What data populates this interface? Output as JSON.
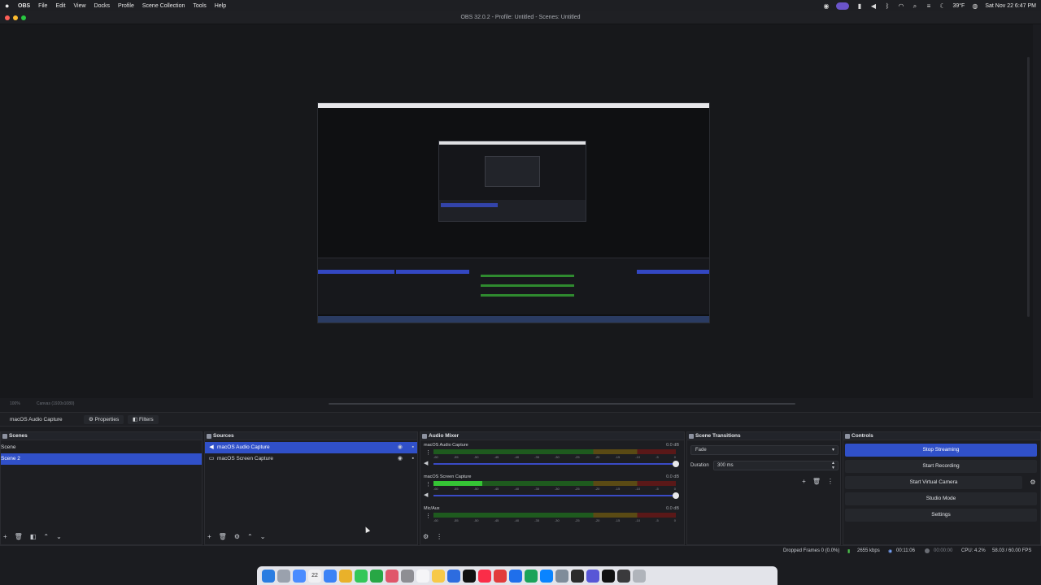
{
  "menubar": {
    "app": "OBS",
    "items": [
      "File",
      "Edit",
      "View",
      "Docks",
      "Profile",
      "Scene Collection",
      "Tools",
      "Help"
    ],
    "weather": "39°F",
    "datetime": "Sat Nov 22 6:47 PM"
  },
  "window": {
    "title": "OBS 32.0.2 - Profile: Untitled - Scenes: Untitled"
  },
  "preview": {
    "zoom": "100%",
    "canvas": "Canvas (1920x1080)"
  },
  "source_bar": {
    "selected_source": "macOS Audio Capture",
    "properties_label": "Properties",
    "filters_label": "Filters"
  },
  "scenes": {
    "title": "Scenes",
    "items": [
      {
        "label": "Scene",
        "selected": false
      },
      {
        "label": "Scene 2",
        "selected": true
      }
    ]
  },
  "sources": {
    "title": "Sources",
    "items": [
      {
        "label": "macOS Audio Capture",
        "icon": "speaker-icon",
        "selected": true
      },
      {
        "label": "macOS Screen Capture",
        "icon": "monitor-icon",
        "selected": false
      }
    ]
  },
  "mixer": {
    "title": "Audio Mixer",
    "ticks": [
      "-60",
      "-55",
      "-50",
      "-45",
      "-40",
      "-35",
      "-30",
      "-25",
      "-20",
      "-15",
      "-10",
      "-5",
      "0"
    ],
    "channels": [
      {
        "name": "macOS Audio Capture",
        "db": "0.0 dB",
        "level": 0.0
      },
      {
        "name": "macOS Screen Capture",
        "db": "0.0 dB",
        "level": 0.2
      },
      {
        "name": "Mic/Aux",
        "db": "0.0 dB",
        "level": 0.0
      }
    ]
  },
  "transitions": {
    "title": "Scene Transitions",
    "selected": "Fade",
    "duration_label": "Duration",
    "duration_value": "300 ms"
  },
  "controls": {
    "title": "Controls",
    "buttons": [
      "Stop Streaming",
      "Start Recording",
      "Start Virtual Camera",
      "Studio Mode",
      "Settings"
    ]
  },
  "status": {
    "dropped_frames": "Dropped Frames 0 (0.0%)",
    "bitrate": "2655 kbps",
    "stream_time": "00:11:06",
    "record_time": "00:00:00",
    "cpu": "CPU: 4.2%",
    "fps": "58.03 / 60.00 FPS"
  },
  "dock": {
    "calendar_date": "22",
    "accent": "#3050c8"
  }
}
